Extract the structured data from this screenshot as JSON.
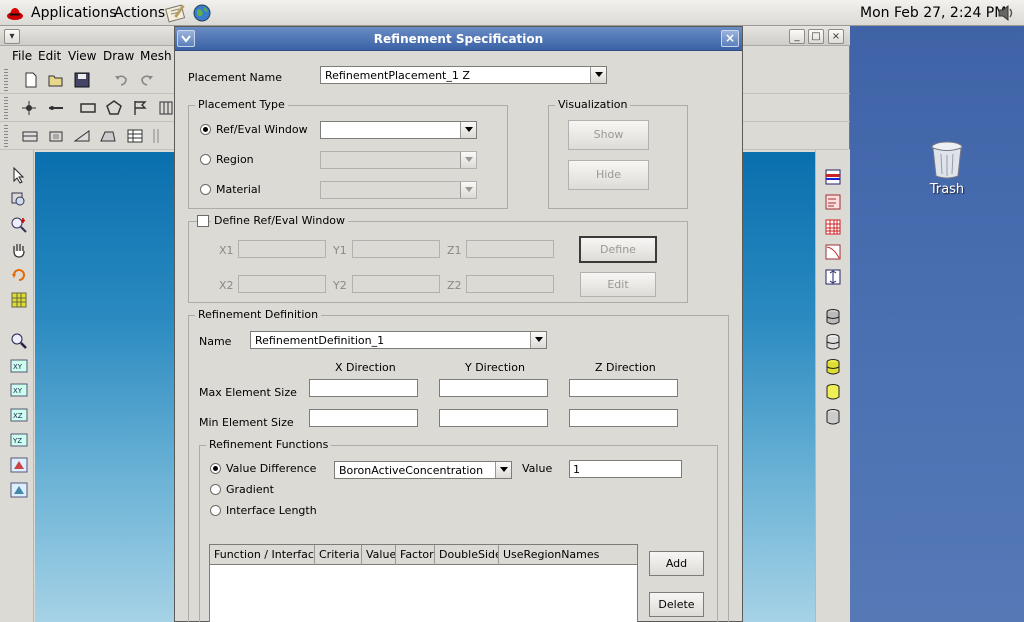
{
  "top_panel": {
    "menus": [
      "Applications",
      "Actions"
    ],
    "clock": "Mon Feb 27,  2:24 PM"
  },
  "desktop": {
    "trash_label": "Trash"
  },
  "app": {
    "menu": [
      "File",
      "Edit",
      "View",
      "Draw",
      "Mesh"
    ],
    "window_buttons": [
      "_",
      "□",
      "×"
    ]
  },
  "dialog": {
    "title": "Refinement Specification",
    "close_glyph": "×",
    "placement_name_label": "Placement Name",
    "placement_name_value": "RefinementPlacement_1 Z",
    "placement_type": {
      "title": "Placement Type",
      "options": [
        {
          "label": "Ref/Eval Window",
          "selected": true,
          "combo_value": ""
        },
        {
          "label": "Region",
          "selected": false,
          "combo_value": ""
        },
        {
          "label": "Material",
          "selected": false,
          "combo_value": ""
        }
      ]
    },
    "visualization": {
      "title": "Visualization",
      "show": "Show",
      "hide": "Hide"
    },
    "ref_window": {
      "title": "Define Ref/Eval Window",
      "checked": false,
      "coords": [
        {
          "label": "X1",
          "value": ""
        },
        {
          "label": "Y1",
          "value": ""
        },
        {
          "label": "Z1",
          "value": ""
        },
        {
          "label": "X2",
          "value": ""
        },
        {
          "label": "Y2",
          "value": ""
        },
        {
          "label": "Z2",
          "value": ""
        }
      ],
      "define": "Define",
      "edit": "Edit"
    },
    "refinement_definition": {
      "title": "Refinement Definition",
      "name_label": "Name",
      "name_value": "RefinementDefinition_1",
      "columns": [
        "X Direction",
        "Y Direction",
        "Z Direction"
      ],
      "max_label": "Max Element Size",
      "min_label": "Min Element Size",
      "max_values": [
        "",
        "",
        ""
      ],
      "min_values": [
        "",
        "",
        ""
      ]
    },
    "refinement_functions": {
      "title": "Refinement Functions",
      "options": [
        {
          "label": "Value Difference",
          "selected": true
        },
        {
          "label": "Gradient",
          "selected": false
        },
        {
          "label": "Interface Length",
          "selected": false
        }
      ],
      "function_combo": "BoronActiveConcentration",
      "value_label": "Value",
      "value": "1",
      "table_headers": [
        "Function / Interface",
        "Criteria",
        "Value",
        "Factor",
        "DoubleSide",
        "UseRegionNames"
      ],
      "add": "Add",
      "delete": "Delete"
    }
  }
}
